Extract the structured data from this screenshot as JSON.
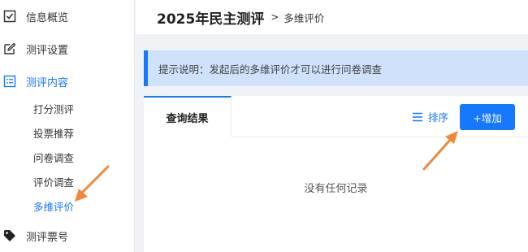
{
  "sidebar": {
    "items": [
      {
        "label": "信息概览",
        "icon": "checkbox-icon"
      },
      {
        "label": "测评设置",
        "icon": "edit-icon"
      },
      {
        "label": "测评内容",
        "icon": "list-icon"
      },
      {
        "label": "测评票号",
        "icon": "tag-icon"
      }
    ],
    "subitems": [
      "打分测评",
      "投票推荐",
      "问卷调查",
      "评价调查",
      "多维评价"
    ]
  },
  "header": {
    "title": "2025年民主测评",
    "separator": ">",
    "crumb": "多维评价"
  },
  "tip": {
    "text": "提示说明：发起后的多维评价才可以进行问卷调查"
  },
  "panel": {
    "tab_label": "查询结果",
    "sort_label": "排序",
    "add_label": "+增加",
    "empty_text": "没有任何记录"
  },
  "colors": {
    "accent": "#1677ff",
    "tip_bg": "#cfe1fb",
    "arrow": "#f0883a"
  }
}
